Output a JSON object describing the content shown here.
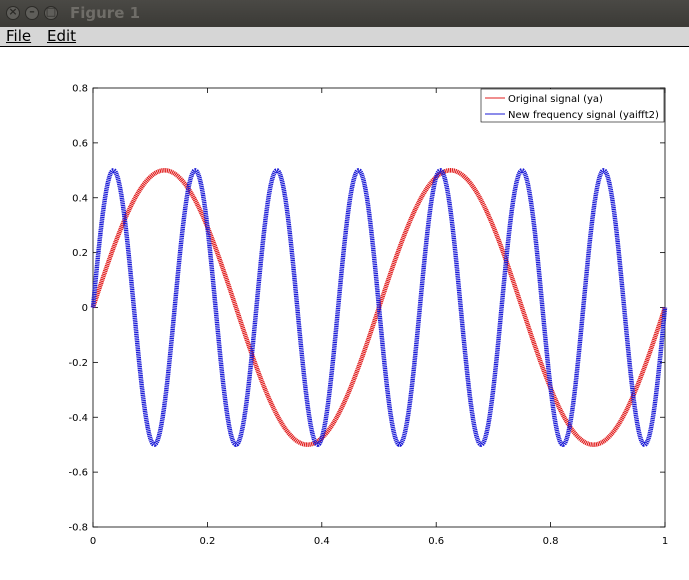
{
  "window": {
    "title": "Figure 1",
    "close_glyph": "×",
    "minimize_glyph": "–",
    "maximize_glyph": "□"
  },
  "menu": {
    "file": "File",
    "edit": "Edit"
  },
  "chart_data": {
    "type": "line",
    "title": "",
    "xlabel": "",
    "ylabel": "",
    "xlim": [
      0,
      1
    ],
    "ylim": [
      -0.8,
      0.8
    ],
    "x_ticks": [
      "0",
      "0.2",
      "0.4",
      "0.6",
      "0.8",
      "1"
    ],
    "y_ticks": [
      "0.8",
      "0.6",
      "0.4",
      "0.2",
      "0",
      "-0.2",
      "-0.4",
      "-0.6",
      "-0.8"
    ],
    "grid": false,
    "legend_position": "top-right",
    "series": [
      {
        "name": "Original signal (ya)",
        "color": "#e11d1d",
        "amplitude": 0.5,
        "frequency": 2,
        "x_range": [
          0,
          1
        ]
      },
      {
        "name": "New frequency signal (yaifft2)",
        "color": "#1a1ad6",
        "amplitude": 0.5,
        "frequency": 7,
        "x_range": [
          0,
          1
        ]
      }
    ]
  }
}
